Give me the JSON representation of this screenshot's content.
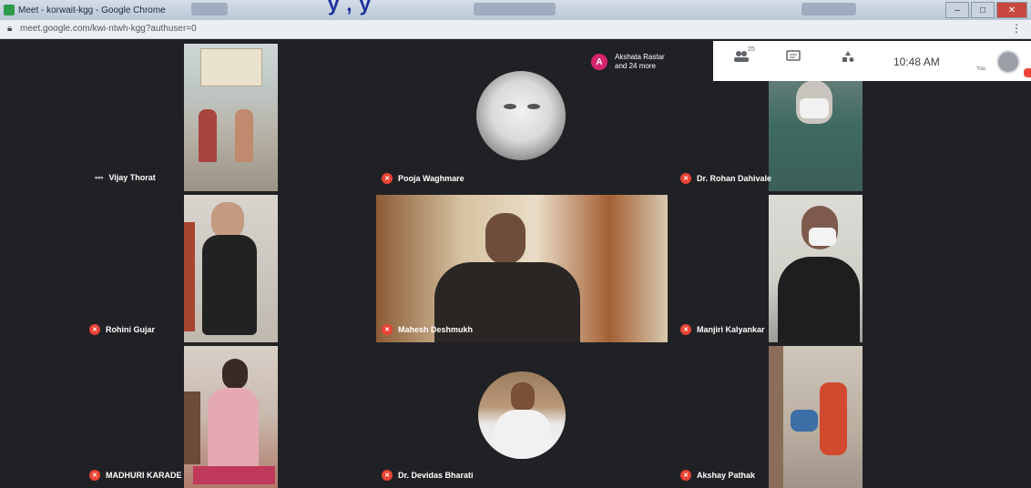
{
  "browser": {
    "window_title": "Meet - korwait-kgg - Google Chrome",
    "url": "meet.google.com/kwi-ntwh-kgg?authuser=0",
    "caption_overlay": "y , y"
  },
  "meet": {
    "notice": {
      "avatar_initial": "A",
      "line1": "Akshata Rastar",
      "line2": "and 24 more"
    },
    "people_count": "25",
    "time": "10:48 AM",
    "self_label": "You"
  },
  "participants": [
    {
      "name": "Vijay Thorat",
      "muted": false
    },
    {
      "name": "Pooja Waghmare",
      "muted": true
    },
    {
      "name": "Dr. Rohan Dahivale",
      "muted": true
    },
    {
      "name": "Rohini Gujar",
      "muted": true
    },
    {
      "name": "Mahesh Deshmukh",
      "muted": true
    },
    {
      "name": "Manjiri Kalyankar",
      "muted": true
    },
    {
      "name": "MADHURI KARADE",
      "muted": true
    },
    {
      "name": "Dr. Devidas Bharati",
      "muted": true
    },
    {
      "name": "Akshay Pathak",
      "muted": true
    }
  ],
  "colors": {
    "meet_bg": "#202124",
    "tile_bg": "#3c4043",
    "mic_off_red": "#ea4335",
    "notice_avatar": "#d6246e"
  },
  "icons": {
    "mic_off": "mic-off-icon",
    "people": "people-icon",
    "chat": "chat-icon",
    "activities": "activities-icon",
    "lock": "lock-icon",
    "more": "more-vert-icon"
  }
}
